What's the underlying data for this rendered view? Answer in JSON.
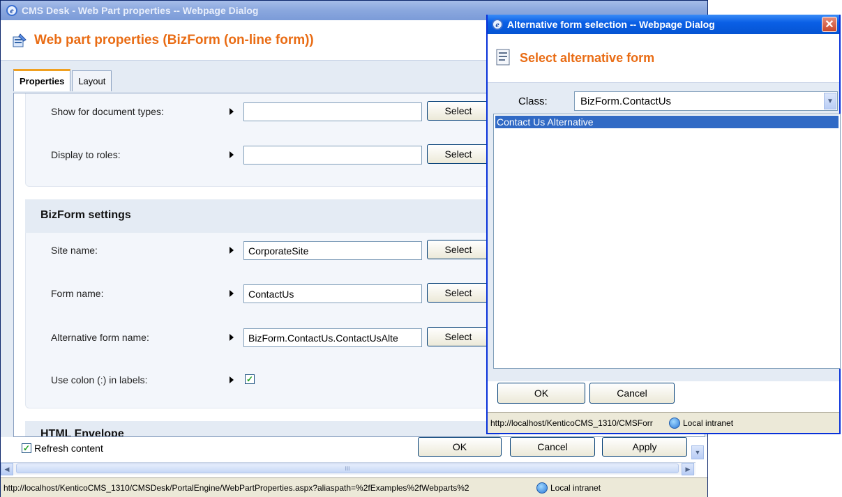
{
  "main_window": {
    "title": "CMS Desk - Web Part properties -- Webpage Dialog",
    "header_title": "Web part properties (BizForm (on-line form))",
    "tabs": [
      {
        "label": "Properties",
        "active": true
      },
      {
        "label": "Layout",
        "active": false
      }
    ],
    "visibility_fields": [
      {
        "label": "Show for document types:",
        "value": "",
        "button": "Select"
      },
      {
        "label": "Display to roles:",
        "value": "",
        "button": "Select"
      }
    ],
    "bizform_section": {
      "title": "BizForm settings",
      "fields": [
        {
          "label": "Site name:",
          "value": "CorporateSite",
          "button": "Select"
        },
        {
          "label": "Form name:",
          "value": "ContactUs",
          "button": "Select"
        },
        {
          "label": "Alternative form name:",
          "value": "BizForm.ContactUs.ContactUsAlte",
          "button": "Select"
        }
      ],
      "checkbox_field": {
        "label": "Use colon (:) in labels:",
        "checked": true
      }
    },
    "next_section_partial": "HTML Envelope",
    "refresh_content": {
      "label": "Refresh content",
      "checked": true
    },
    "buttons": {
      "ok": "OK",
      "cancel": "Cancel",
      "apply": "Apply"
    },
    "scroll_thumb_glyph": "III",
    "status_url": "http://localhost/KenticoCMS_1310/CMSDesk/PortalEngine/WebPartProperties.aspx?aliaspath=%2fExamples%2fWebparts%2",
    "status_zone": "Local intranet"
  },
  "popup_window": {
    "title": "Alternative form selection -- Webpage Dialog",
    "header_title": "Select alternative form",
    "class_label": "Class:",
    "class_value": "BizForm.ContactUs",
    "list_items": [
      "Contact Us Alternative"
    ],
    "buttons": {
      "ok": "OK",
      "cancel": "Cancel"
    },
    "status_url": "http://localhost/KenticoCMS_1310/CMSForr",
    "status_zone": "Local intranet"
  },
  "colors": {
    "header_orange": "#e96c14",
    "selection_blue": "#316ac5",
    "panel_bg": "#e4ebf4"
  }
}
